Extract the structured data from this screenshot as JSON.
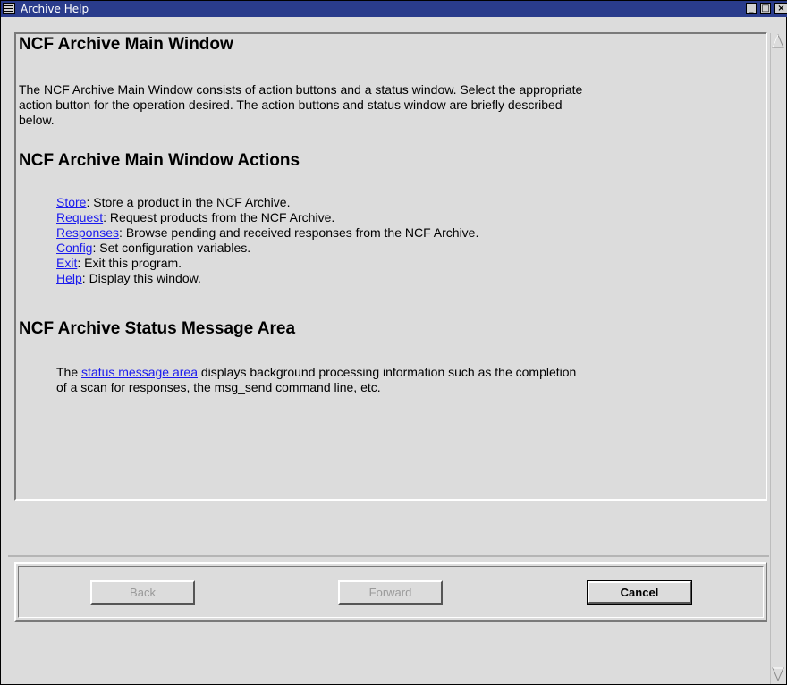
{
  "window": {
    "title": "Archive Help"
  },
  "help": {
    "heading_main": "NCF Archive Main Window",
    "intro_line1": "The NCF Archive Main Window consists of action buttons  and a status window.  Select the appropriate",
    "intro_line2": "action button for  the operation desired.  The action buttons and status window are  briefly described",
    "intro_line3": "below.",
    "heading_actions": "NCF Archive Main Window Actions",
    "actions": [
      {
        "link": "Store",
        "desc": ": Store a product in the NCF Archive."
      },
      {
        "link": "Request",
        "desc": ": Request products from the NCF Archive."
      },
      {
        "link": "Responses",
        "desc": ": Browse pending and received responses from the  NCF Archive."
      },
      {
        "link": "Config",
        "desc": ": Set configuration variables."
      },
      {
        "link": "Exit",
        "desc": ": Exit this program."
      },
      {
        "link": "Help",
        "desc": ": Display this window."
      }
    ],
    "heading_status": "NCF Archive Status Message Area",
    "status_prefix": "The ",
    "status_link": "status message area",
    "status_suffix": " displays background processing information such as  the completion",
    "status_line2": "of a scan for responses, the msg_send command  line, etc."
  },
  "buttons": {
    "back": "Back",
    "forward": "Forward",
    "cancel": "Cancel"
  },
  "colors": {
    "titlebar": "#2a3c8c",
    "link": "#1a1aee",
    "background": "#dcdcdc"
  }
}
